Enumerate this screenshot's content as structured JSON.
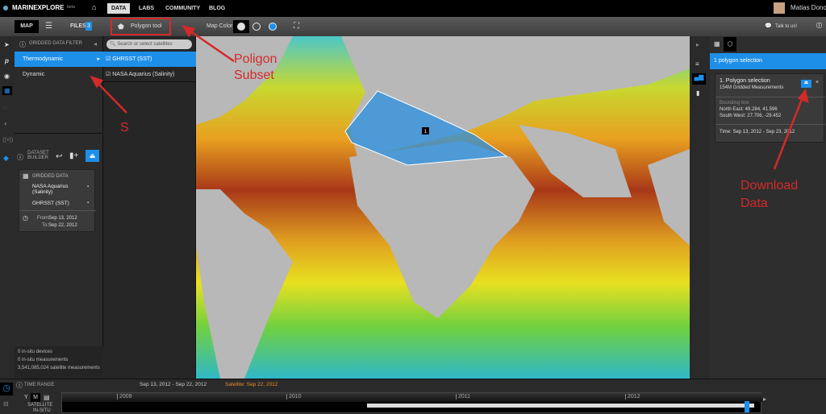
{
  "topbar": {
    "brand": "MARINEXPLORE",
    "brand_sub": "beta",
    "nav": [
      "DATA",
      "LABS",
      "COMMUNITY",
      "BLOG"
    ],
    "active": "DATA",
    "user": "Matias Dono"
  },
  "toolbar": {
    "map": "MAP",
    "files": "FILES",
    "files_count": "3",
    "polygon_tool": "Polygon tool",
    "map_color": "Map Color",
    "talk": "Talk to us!"
  },
  "filter": {
    "title": "GRIDDED DATA FILTER",
    "categories": [
      "Thermodynamic",
      "Dynamic"
    ],
    "search_placeholder": "Search or select satellites",
    "datasets": [
      "GHRSST (SST)",
      "NASA Aquarius (Salinity)"
    ]
  },
  "builder": {
    "title": "DATASET BUILDER",
    "section": "GRIDDED DATA",
    "items": [
      "NASA Aquarius (Salinity)",
      "GHRSST (SST)"
    ],
    "from_label": "From:",
    "from": "Sep 13, 2012",
    "to_label": "To:",
    "to": "Sep 22, 2012"
  },
  "stats": [
    "0 in-situ devices",
    "0 in-situ measurements",
    "3,541,085,024 satellite measurements"
  ],
  "map": {
    "polygon_label": "1"
  },
  "right": {
    "header": "1 polygon selection",
    "card_title": "1. Polygon selection",
    "card_sub": "154M Gridded Measurements",
    "bbox_label": "Bounding box",
    "ne": "North East: 49.284, 41.596",
    "sw": "South West: 27.706, -29.452",
    "time": "Time: Sep 13, 2012 - Sep 23, 2012"
  },
  "timeline": {
    "title": "TIME RANGE",
    "range": "Sep 13, 2012 - Sep 22, 2012",
    "satellite": "Satellite: Sep 22, 2012",
    "years": [
      "2009",
      "2010",
      "2011",
      "2012"
    ],
    "y": "Y",
    "m": "M",
    "satellite_label": "SATELLITE",
    "insitu_label": "IN-SITU"
  },
  "annotations": {
    "polygon": "Poligon\nSubset",
    "s": "S",
    "download": "Download\nData"
  },
  "colors": {
    "accent": "#1e8fe8",
    "annotation": "#d42a2a",
    "satellite": "#e8902a"
  }
}
